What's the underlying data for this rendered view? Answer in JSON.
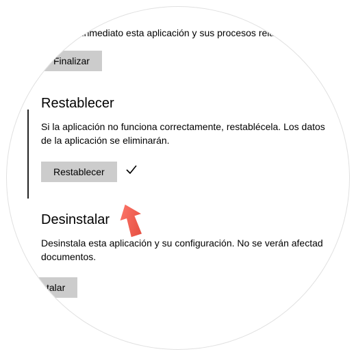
{
  "terminate": {
    "partial_desc": "de inmediato esta aplicación y sus procesos relaci",
    "button": "Finalizar"
  },
  "reset": {
    "heading": "Restablecer",
    "desc": "Si la aplicación no funciona correctamente, restablécela. Los datos de la aplicación se eliminarán.",
    "button": "Restablecer"
  },
  "uninstall": {
    "heading": "Desinstalar",
    "desc": "Desinstala esta aplicación y su configuración. No se verán afectad documentos.",
    "button": "talar"
  }
}
